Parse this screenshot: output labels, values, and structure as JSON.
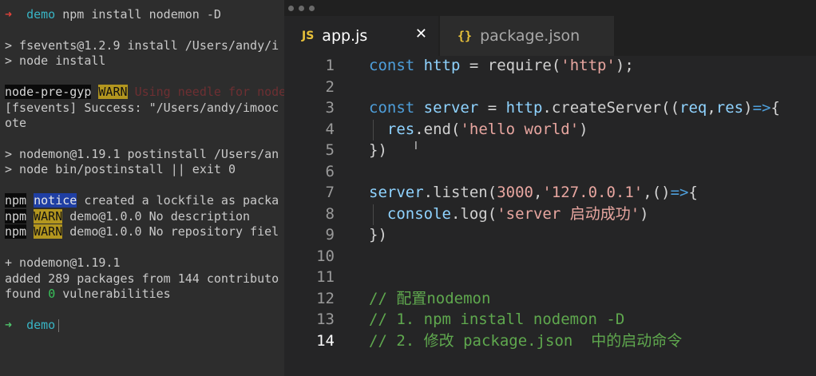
{
  "terminal": {
    "cmd_dir": "demo",
    "cmd_text": "npm install nodemon -D",
    "line_fsevents": "> fsevents@1.2.9 install /Users/andy/i",
    "line_node_install": "> node install",
    "line_npg_tag": "node-pre-gyp",
    "line_npg_warn": "WARN",
    "line_npg_msg": "Using needle for node",
    "line_success": "[fsevents] Success: \"/Users/andy/imooc",
    "line_ote": "ote",
    "line_postinstall": "> nodemon@1.19.1 postinstall /Users/an",
    "line_bin": "> node bin/postinstall || exit 0",
    "npm_label": "npm",
    "notice_tag": "notice",
    "notice_msg": "created a lockfile as packa",
    "warn_tag": "WARN",
    "warn_msg_1": "demo@1.0.0 No description",
    "warn_msg_2": "demo@1.0.0 No repository fiel",
    "line_added_pkg": "+ nodemon@1.19.1",
    "line_added": "added 289 packages from 144 contributo",
    "found_prefix": "found",
    "found_count": "0",
    "found_suffix": "vulnerabilities",
    "prompt_dir": "demo"
  },
  "editor": {
    "tabs": [
      {
        "icon": "JS",
        "label": "app.js",
        "active": true,
        "close": "✕"
      },
      {
        "icon": "{}",
        "label": "package.json",
        "active": false
      }
    ],
    "line_numbers": [
      "1",
      "2",
      "3",
      "4",
      "5",
      "6",
      "7",
      "8",
      "9",
      "10",
      "11",
      "12",
      "13",
      "14"
    ],
    "active_line": "14",
    "code": {
      "l1_kw": "const",
      "l1_var": "http",
      "l1_eq": " = ",
      "l1_fn": "require",
      "l1_open": "(",
      "l1_str": "'http'",
      "l1_close": ");",
      "l3_kw": "const",
      "l3_var": "server",
      "l3_eq": " = ",
      "l3_obj": "http",
      "l3_dot": ".",
      "l3_fn": "createServer",
      "l3_open": "((",
      "l3_p1": "req",
      "l3_comma": ",",
      "l3_p2": "res",
      "l3_close": ")",
      "l3_arrow": "=>",
      "l3_brace": "{",
      "l4_obj": "res",
      "l4_dot": ".",
      "l4_fn": "end",
      "l4_open": "(",
      "l4_str": "'hello world'",
      "l4_close": ")",
      "l5": "})",
      "l7_obj": "server",
      "l7_dot": ".",
      "l7_fn": "listen",
      "l7_open": "(",
      "l7_num": "3000",
      "l7_comma": ",",
      "l7_str": "'127.0.0.1'",
      "l7_comma2": ",",
      "l7_parens": "()",
      "l7_arrow": "=>",
      "l7_brace": "{",
      "l8_obj": "console",
      "l8_dot": ".",
      "l8_fn": "log",
      "l8_open": "(",
      "l8_str": "'server 启动成功'",
      "l8_close": ")",
      "l9": "})",
      "l12": "// 配置nodemon",
      "l13": "// 1. npm install nodemon -D",
      "l14": "// 2. 修改 package.json  中的启动命令"
    }
  },
  "colors": {
    "keyword": "#4e9fdb",
    "string": "#e8a6a0",
    "comment": "#5fa84e",
    "terminal_bg": "#2d2d2d",
    "editor_bg": "#252526",
    "warn_yellow": "#b3961f",
    "notice_blue": "#1f3fa4"
  }
}
